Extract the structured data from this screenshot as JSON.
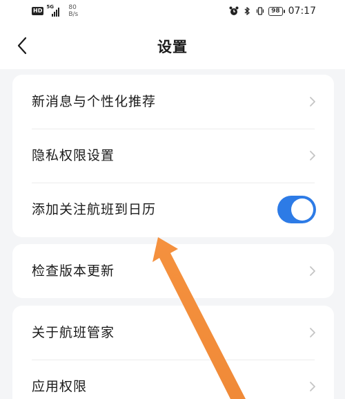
{
  "status_bar": {
    "hd": "HD",
    "network": "5G",
    "net_speed_value": "80",
    "net_speed_unit": "B/s",
    "battery": "98",
    "time": "07:17"
  },
  "header": {
    "title": "设置"
  },
  "settings": {
    "group1": [
      {
        "label": "新消息与个性化推荐"
      },
      {
        "label": "隐私权限设置"
      },
      {
        "label": "添加关注航班到日历",
        "toggle_on": true
      }
    ],
    "group2": [
      {
        "label": "检查版本更新"
      }
    ],
    "group3": [
      {
        "label": "关于航班管家"
      },
      {
        "label": "应用权限"
      }
    ]
  },
  "colors": {
    "toggle_on": "#2d7be6",
    "arrow": "#f28c3c",
    "background": "#f4f5f7"
  }
}
